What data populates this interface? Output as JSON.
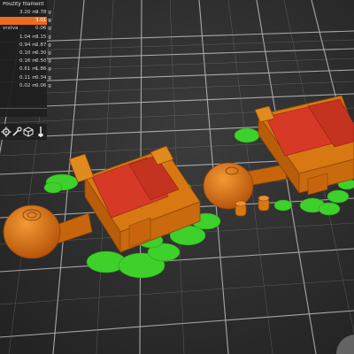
{
  "legend": {
    "header": "Použitý filament",
    "rows": [
      {
        "label": "",
        "length": "3.20 m",
        "weight": "9.78 g",
        "selected": false
      },
      {
        "label": "",
        "length": "",
        "weight": "3.01 g",
        "selected": true
      },
      {
        "label": "vrstva",
        "length": "",
        "weight": "0.06 g",
        "selected": false
      },
      {
        "label": "",
        "length": "1.04 m",
        "weight": "3.15 g",
        "selected": false
      },
      {
        "label": "",
        "length": "0.94 m",
        "weight": "2.87 g",
        "selected": false
      },
      {
        "label": "",
        "length": "0.10 m",
        "weight": "0.30 g",
        "selected": false
      },
      {
        "label": "",
        "length": "0.16 m",
        "weight": "0.50 g",
        "selected": false
      },
      {
        "label": "",
        "length": "0.61 m",
        "weight": "1.86 g",
        "selected": false
      },
      {
        "label": "",
        "length": "0.11 m",
        "weight": "0.34 g",
        "selected": false
      },
      {
        "label": "",
        "length": "0.02 m",
        "weight": "0.06 g",
        "selected": false
      }
    ]
  },
  "toolbar": {
    "icons": [
      "cog-icon",
      "settings-icon",
      "cube-view-icon",
      "layer-slider-icon"
    ]
  },
  "colors": {
    "background": "#2e2e2e",
    "grid": "#bdbdbd",
    "model_orange": "#e07a10",
    "model_red": "#d63a26",
    "support_green": "#3ed12b",
    "accent": "#ed6b21"
  }
}
